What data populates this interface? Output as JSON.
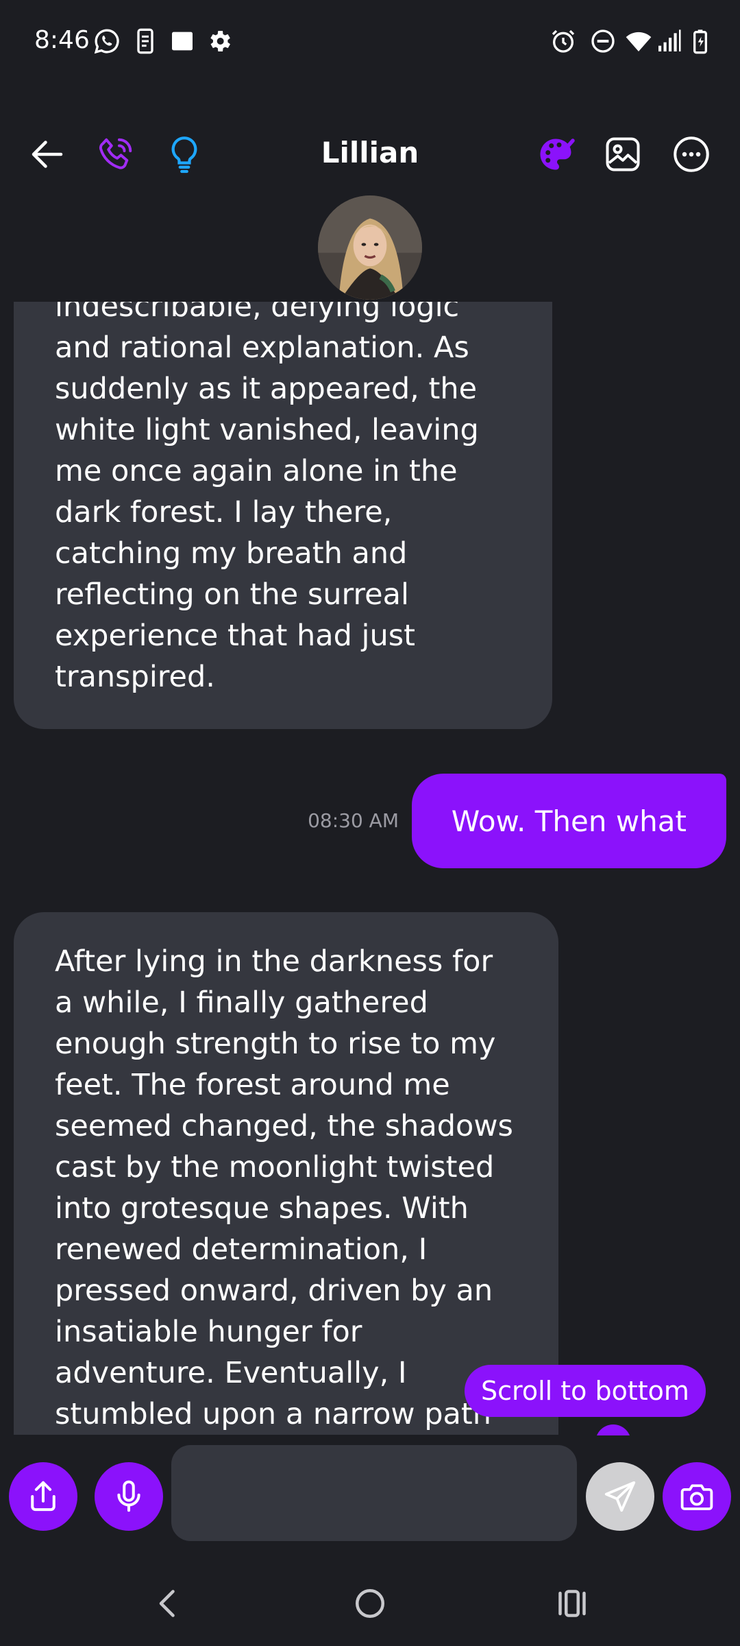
{
  "status_bar": {
    "time": "8:46",
    "left_icons": [
      "whatsapp-icon",
      "phone-clipboard-icon",
      "square-icon",
      "gear-icon"
    ],
    "right_icons": [
      "alarm-icon",
      "do-not-disturb-icon",
      "wifi-icon",
      "signal-icon",
      "battery-charging-icon"
    ]
  },
  "header": {
    "contact_name": "Lillian",
    "left_icons": [
      "back-arrow-icon",
      "phone-call-icon",
      "lightbulb-icon"
    ],
    "right_icons": [
      "palette-icon",
      "image-icon",
      "more-options-icon"
    ]
  },
  "conversation": {
    "messages": [
      {
        "sender": "bot",
        "text": "indescribable, defying logic and rational explanation. As suddenly as it appeared, the white light vanished, leaving me once again alone in the dark forest. I lay there, catching my breath and reflecting on the surreal experience that had just transpired."
      },
      {
        "sender": "user",
        "time": "08:30 AM",
        "text": "Wow. Then what"
      },
      {
        "sender": "bot",
        "text": "After lying in the darkness for a while, I finally gathered enough strength to rise to my feet. The forest around me seemed changed, the shadows cast by the moonlight twisted into grotesque shapes. With renewed determination, I pressed onward, driven by an insatiable hunger for adventure. Eventually, I stumbled upon a narrow path winding its way through the thick"
      }
    ],
    "scroll_button_label": "Scroll to bottom"
  },
  "input_bar": {
    "message_value": "",
    "placeholder": "",
    "icons": [
      "share-icon",
      "microphone-icon",
      "send-icon",
      "camera-icon"
    ]
  },
  "nav_bar": {
    "icons": [
      "nav-back-icon",
      "nav-home-icon",
      "nav-recents-icon"
    ]
  },
  "colors": {
    "background": "#1c1d22",
    "bot_bubble": "#35373f",
    "accent_purple": "#8b12fb",
    "phone_icon": "#a12cf5",
    "lightbulb_icon": "#1ea7ff",
    "timestamp": "#9b9ba3"
  }
}
